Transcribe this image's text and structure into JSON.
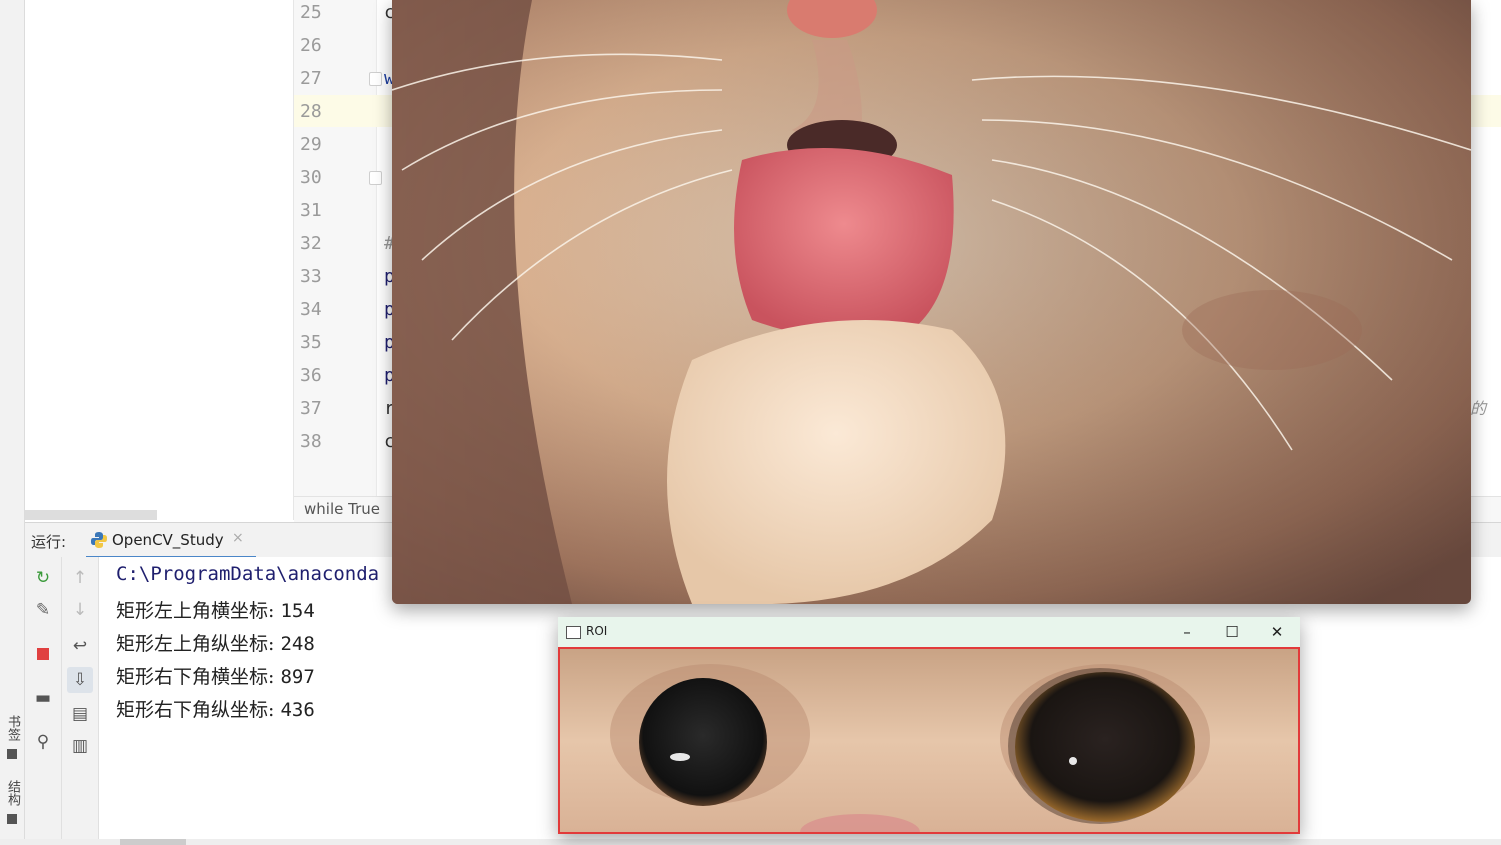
{
  "sidebar": {
    "vertical_tabs": [
      "书签",
      "结构"
    ]
  },
  "editor": {
    "line_numbers": [
      "25",
      "26",
      "27",
      "28",
      "29",
      "30",
      "31",
      "32",
      "33",
      "34",
      "35",
      "36",
      "37",
      "38"
    ],
    "code_fragments": [
      "c",
      "",
      "w",
      "",
      "",
      "",
      "",
      "#",
      "p",
      "p",
      "p",
      "p",
      "r",
      "c"
    ],
    "right_fragment": "的",
    "breadcrumb": "while True"
  },
  "run_panel": {
    "label": "运行:",
    "tab_label": "OpenCV_Study",
    "console": {
      "command": "C:\\ProgramData\\anaconda",
      "lines": [
        {
          "label": "矩形左上角横坐标:",
          "value": "154"
        },
        {
          "label": "矩形左上角纵坐标:",
          "value": "248"
        },
        {
          "label": "矩形右下角横坐标:",
          "value": "897"
        },
        {
          "label": "矩形右下角纵坐标:",
          "value": "436"
        }
      ]
    }
  },
  "roi_window": {
    "title": "ROI"
  },
  "colors": {
    "accent": "#4a86c8",
    "roi_border": "#e23a3a",
    "console_path": "#1f1f6e"
  }
}
